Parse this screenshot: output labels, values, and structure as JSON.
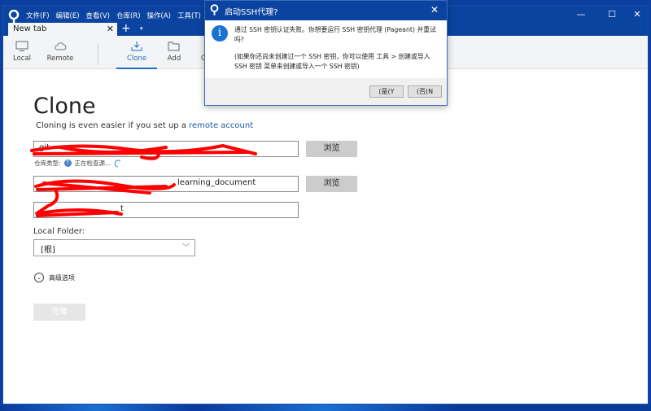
{
  "menu": [
    "文件(F)",
    "编辑(E)",
    "查看(V)",
    "仓库(R)",
    "操作(A)",
    "工具(T)",
    "帮"
  ],
  "tab": {
    "label": "New tab",
    "close": "✕",
    "add": "+",
    "dropdown": "▾"
  },
  "window_controls": {
    "minimize": "—",
    "maximize": "☐",
    "close": "✕"
  },
  "toolbar": {
    "local": "Local",
    "remote": "Remote",
    "clone": "Clone",
    "add": "Add",
    "create": "C"
  },
  "main": {
    "title": "Clone",
    "subtitle": "Cloning is even easier if you set up a ",
    "subtitle_link": "remote account",
    "source_url": "git",
    "browse1": "浏览",
    "repo_type_label": "仓库类型:",
    "repo_type_status": "正在检查源...",
    "dest_path": "learning_document",
    "browse2": "浏览",
    "name": "t",
    "local_folder_label": "Local Folder:",
    "local_folder_value": "[根]",
    "advanced": "高级选项",
    "clone_button": "克隆"
  },
  "dialog": {
    "title": "启动SSH代理?",
    "message": "通过 SSH 密钥认证失败。你想要运行 SSH 密钥代理 (Pageant) 并重试吗?",
    "note": "(如果你还尚未创建过一个 SSH 密钥，你可以使用 工具 > 创建或导入 SSH 密钥 菜单来创建或导入一个 SSH 密钥)",
    "yes": "(是(Y",
    "no": "(否(N",
    "close": "✕",
    "icon": "info-icon"
  },
  "colors": {
    "titlebar": "#0a44a0",
    "accent": "#1e6ec8",
    "redaction": "#ff0000"
  }
}
